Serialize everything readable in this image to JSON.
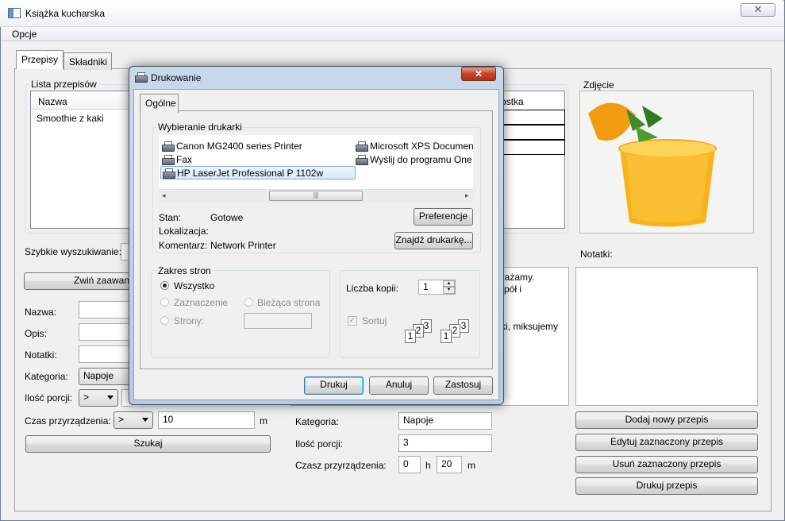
{
  "window": {
    "title": "Książka kucharska",
    "close": "✕"
  },
  "menu": {
    "options": "Opcje"
  },
  "tabs": {
    "recipes": "Przepisy",
    "ingredients": "Składniki"
  },
  "recipe_list": {
    "label": "Lista przepisów",
    "col_name": "Nazwa",
    "items": [
      "Smoothie z kaki"
    ]
  },
  "ingredients": {
    "label": "Składniki",
    "col_qty": "Jednostka"
  },
  "photo": {
    "label": "Zdjęcie"
  },
  "notes": {
    "label": "Notatki:"
  },
  "search": {
    "quick_label": "Szybkie wyszukiwanie:",
    "collapse_btn": "Zwiń zaawansowane",
    "name_label": "Nazwa:",
    "desc_label": "Opis:",
    "notes_label": "Notatki:",
    "category_label": "Kategoria:",
    "category_value": "Napoje",
    "portions_label": "Ilość porcji:",
    "portions_op": ">",
    "time_label": "Czas przyrządzenia:",
    "time_op": ">",
    "time_value": "10",
    "time_unit": "m",
    "search_btn": "Szukaj"
  },
  "description": {
    "line1": "nrażamy.",
    "line2": "a pół i",
    "line3": "ski, miksujemy"
  },
  "details": {
    "category_label": "Kategoria:",
    "category_value": "Napoje",
    "portions_label": "Ilość porcji:",
    "portions_value": "3",
    "time_label": "Czasz przyrządzenia:",
    "hours": "0",
    "h": "h",
    "minutes": "20",
    "m": "m"
  },
  "actions": {
    "add": "Dodaj nowy przepis",
    "edit": "Edytuj zaznaczony przepis",
    "delete": "Usuń zaznaczony przepis",
    "print": "Drukuj przepis"
  },
  "print_dialog": {
    "title": "Drukowanie",
    "close": "✕",
    "tab": "Ogólne",
    "select_group": "Wybieranie drukarki",
    "printers": [
      "Canon MG2400 series Printer",
      "Microsoft XPS Documen",
      "Fax",
      "Wyślij do programu One",
      "HP LaserJet Professional P 1102w"
    ],
    "selected_printer": "HP LaserJet Professional P 1102w",
    "status_label": "Stan:",
    "status_value": "Gotowe",
    "location_label": "Lokalizacja:",
    "location_value": "",
    "comment_label": "Komentarz:",
    "comment_value": "Network Printer",
    "prefs_btn": "Preferencje",
    "find_btn": "Znajdź drukarkę...",
    "range_group": "Zakres stron",
    "all": "Wszystko",
    "selection": "Zaznaczenie",
    "current_page": "Bieżąca strona",
    "pages": "Strony:",
    "copies_label": "Liczba kopii:",
    "copies_value": "1",
    "collate": "Sortuj",
    "print_btn": "Drukuj",
    "cancel_btn": "Anuluj",
    "apply_btn": "Zastosuj"
  }
}
